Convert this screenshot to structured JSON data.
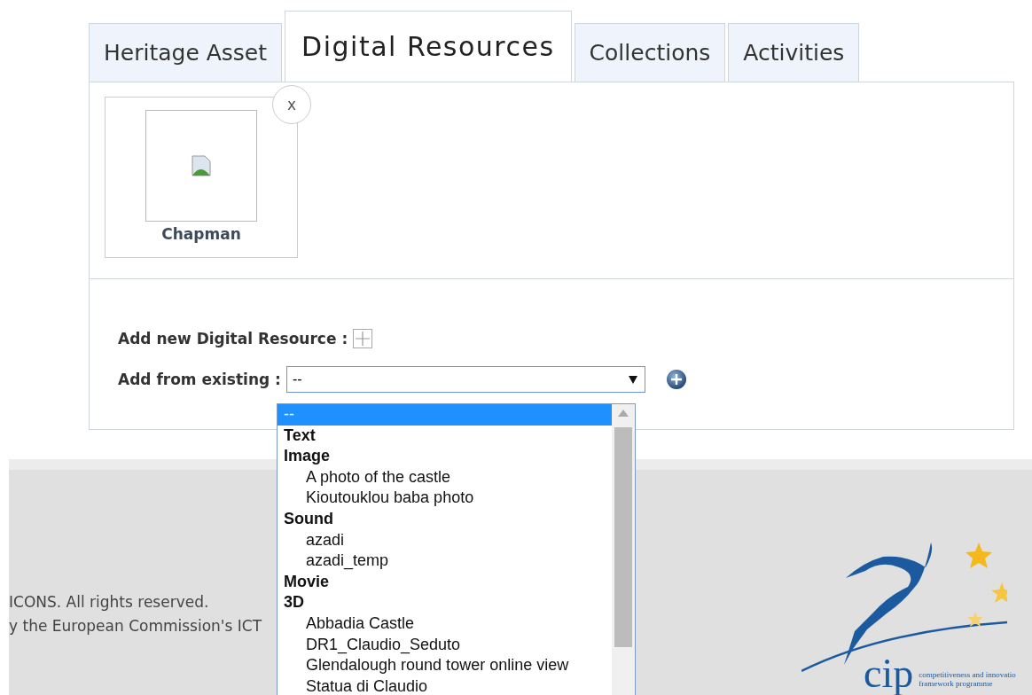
{
  "tabs": [
    {
      "label": "Heritage Asset",
      "selected": false
    },
    {
      "label": "Digital Resources",
      "selected": true
    },
    {
      "label": "Collections",
      "selected": false
    },
    {
      "label": "Activities",
      "selected": false
    }
  ],
  "resources": [
    {
      "name": "Chapman",
      "remove": "x"
    }
  ],
  "add_new": {
    "label": "Add new Digital Resource :"
  },
  "add_existing": {
    "label": "Add from existing :",
    "value": "--"
  },
  "dropdown": [
    {
      "label": "--",
      "kind": "item",
      "selected": true
    },
    {
      "label": "Text",
      "kind": "group",
      "selected": false
    },
    {
      "label": "Image",
      "kind": "group",
      "selected": false
    },
    {
      "label": "A photo of the castle",
      "kind": "item",
      "selected": false
    },
    {
      "label": "Kioutouklou baba photo",
      "kind": "item",
      "selected": false
    },
    {
      "label": "Sound",
      "kind": "group",
      "selected": false
    },
    {
      "label": "azadi",
      "kind": "item",
      "selected": false
    },
    {
      "label": "azadi_temp",
      "kind": "item",
      "selected": false
    },
    {
      "label": "Movie",
      "kind": "group",
      "selected": false
    },
    {
      "label": "3D",
      "kind": "group",
      "selected": false
    },
    {
      "label": "Abbadia Castle",
      "kind": "item",
      "selected": false
    },
    {
      "label": "DR1_Claudio_Seduto",
      "kind": "item",
      "selected": false
    },
    {
      "label": "Glendalough round tower online view",
      "kind": "item",
      "selected": false
    },
    {
      "label": "Statua di Claudio",
      "kind": "item",
      "selected": false
    }
  ],
  "footer": {
    "lines": [
      "ICONS. All rights reserved.",
      "y the European Commission's ICT"
    ],
    "logo": {
      "mark": "cip",
      "lines": [
        "competitiveness and innovatio",
        "framework programme"
      ]
    }
  }
}
